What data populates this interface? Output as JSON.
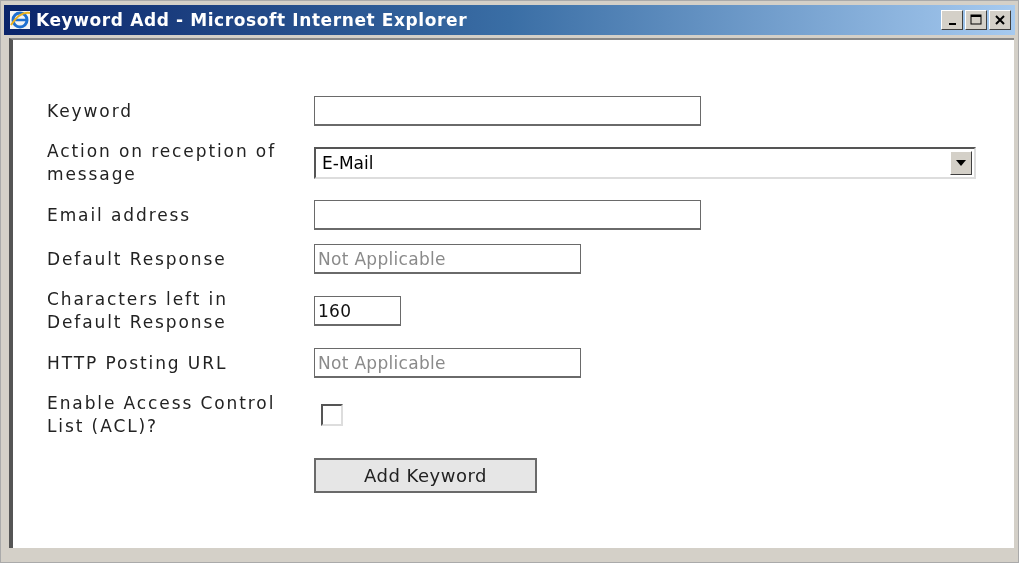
{
  "window": {
    "title": "Keyword Add - Microsoft Internet Explorer"
  },
  "form": {
    "rows": [
      {
        "label": "Keyword",
        "kind": "text"
      },
      {
        "label": "Action on reception of message",
        "kind": "select",
        "value": "E-Mail"
      },
      {
        "label": "Email address",
        "kind": "text"
      },
      {
        "label": "Default Response",
        "kind": "text",
        "value": "Not Applicable",
        "disabled": true
      },
      {
        "label": "Characters left in Default Response",
        "kind": "text",
        "value": "160",
        "disabled": false
      },
      {
        "label": "HTTP Posting URL",
        "kind": "text",
        "value": "Not Applicable",
        "disabled": true
      },
      {
        "label": "Enable Access Control List (ACL)?",
        "kind": "checkbox",
        "checked": false
      }
    ],
    "submit": "Add Keyword"
  }
}
